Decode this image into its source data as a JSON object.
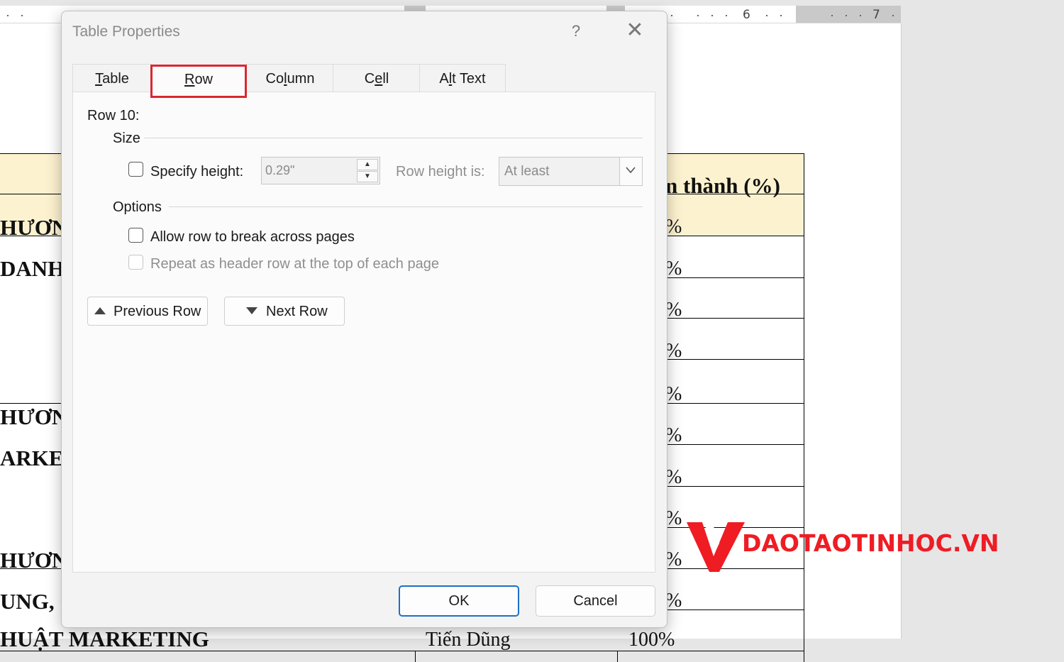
{
  "ruler": {
    "numbers": [
      "6",
      "7"
    ]
  },
  "document": {
    "header_right": "n thành (%)",
    "left_fragments": [
      "HƯƠN",
      "DANH",
      "HƯƠN",
      "ARKE",
      "HƯƠN",
      "UNG, C",
      "HUẬT MARKETING"
    ],
    "percent_cells": [
      "%",
      "%",
      "%",
      "%",
      "%",
      "%",
      "%",
      "%",
      "%",
      "%"
    ],
    "bottom_mid": "Tiến Dũng",
    "bottom_right": "100%"
  },
  "watermark": {
    "text": "DAOTAOTINHOC.VN",
    "color": "#ef1c24"
  },
  "dialog": {
    "title": "Table Properties",
    "help": "?",
    "close": "✕",
    "tabs": [
      {
        "label": "Table",
        "accel_index": 0
      },
      {
        "label": "Row",
        "accel_index": 0,
        "active": true
      },
      {
        "label": "Column",
        "accel_index": 2
      },
      {
        "label": "Cell",
        "accel_index": 1
      },
      {
        "label": "Alt Text",
        "accel_index": 1
      }
    ],
    "row_label": "Row 10:",
    "size": {
      "group_label": "Size",
      "specify_height_label": "Specify height:",
      "specify_height_checked": false,
      "height_value": "0.29\"",
      "row_height_is_label": "Row height is:",
      "row_height_is_value": "At least"
    },
    "options": {
      "group_label": "Options",
      "allow_break_label": "Allow row to break across pages",
      "allow_break_checked": false,
      "repeat_header_label": "Repeat as header row at the top of each page",
      "repeat_header_checked": false
    },
    "prev_row_label": "Previous Row",
    "next_row_label": "Next Row",
    "ok_label": "OK",
    "cancel_label": "Cancel"
  },
  "colors": {
    "active_tab_border": "#d9282f",
    "ok_border": "#1e6fc7",
    "table_header_fill": "#fdf2d0"
  }
}
